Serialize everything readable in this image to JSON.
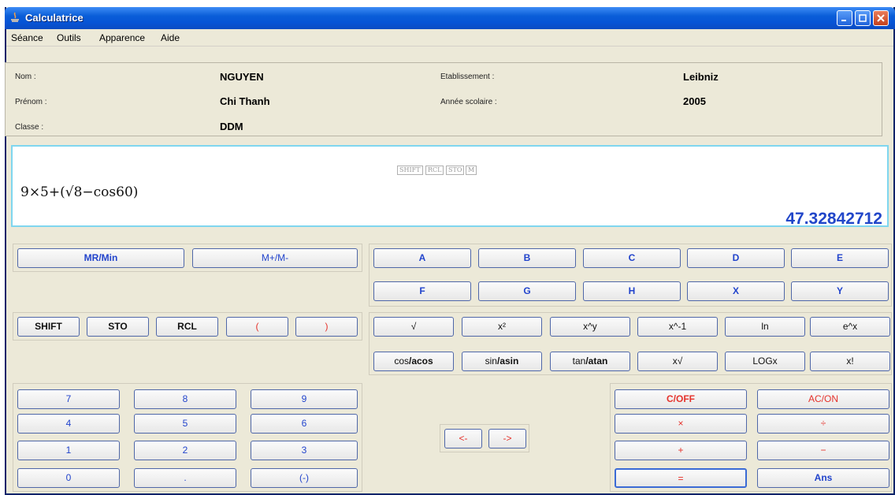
{
  "window": {
    "title": "Calculatrice"
  },
  "menu": [
    "Séance",
    "Outils",
    "Apparence",
    "Aide"
  ],
  "student": {
    "nom_label": "Nom :",
    "nom": "NGUYEN",
    "prenom_label": "Prénom :",
    "prenom": "Chi Thanh",
    "classe_label": "Classe :",
    "classe": "DDM",
    "etab_label": "Etablissement :",
    "etab": "Leibniz",
    "annee_label": "Année scolaire :",
    "annee": "2005"
  },
  "display": {
    "flags": [
      "SHIFT",
      "RCL",
      "STO",
      "M"
    ],
    "expression": "9×5+(√8−cos60)",
    "result": "47.32842712"
  },
  "memory_buttons": [
    "MR/Min",
    "M+/M-"
  ],
  "variable_row1": [
    "A",
    "B",
    "C",
    "D",
    "E"
  ],
  "variable_row2": [
    "F",
    "G",
    "H",
    "X",
    "Y"
  ],
  "mode_buttons": [
    "SHIFT",
    "STO",
    "RCL",
    "(",
    ")"
  ],
  "func_row1": [
    "√",
    "x²",
    "x^y",
    "x^-1",
    "ln",
    "e^x"
  ],
  "func_row2": [
    {
      "a": "cos",
      "b": "/acos"
    },
    {
      "a": "sin",
      "b": "/asin"
    },
    {
      "a": "tan",
      "b": "/atan"
    },
    {
      "a": "x√",
      "b": ""
    },
    {
      "a": "LOGx",
      "b": ""
    },
    {
      "a": "x!",
      "b": ""
    }
  ],
  "keypad": [
    "7",
    "8",
    "9",
    "4",
    "5",
    "6",
    "1",
    "2",
    "3",
    "0",
    ".",
    "(-)"
  ],
  "cursor": [
    "<-",
    "->"
  ],
  "ops": [
    "C/OFF",
    "AC/ON",
    "×",
    "÷",
    "+",
    "−",
    "=",
    "Ans"
  ],
  "colors": {
    "blue_text": "#2244cc",
    "red_text": "#e5322b",
    "result": "#2146c9",
    "display_border": "#7fd6ef"
  }
}
